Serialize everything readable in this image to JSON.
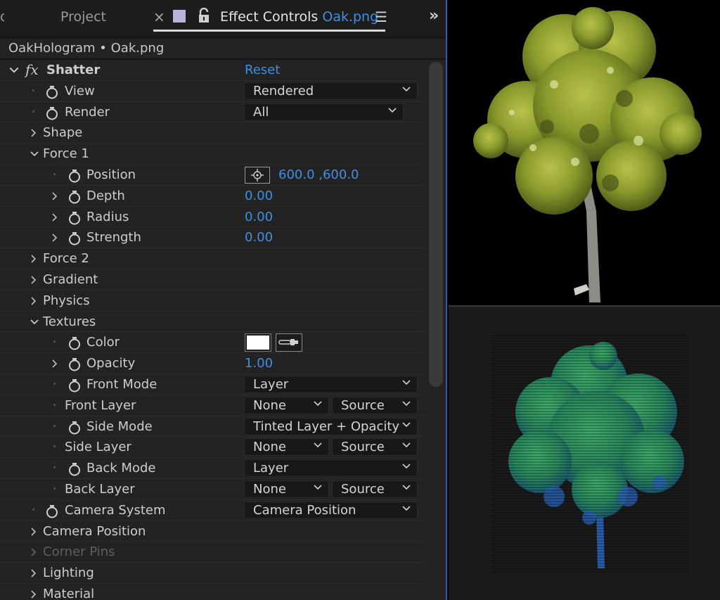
{
  "tabs": {
    "cut_label": "o",
    "project_label": "Project",
    "close_glyph": "×",
    "effect_controls_label": "Effect Controls",
    "file_label": "Oak.png",
    "menu_glyph": "☰",
    "more_glyph": "»"
  },
  "breadcrumb": "OakHologram • Oak.png",
  "effect": {
    "fx_glyph": "fx",
    "name": "Shatter",
    "reset_label": "Reset"
  },
  "properties": {
    "view": {
      "label": "View",
      "value": "Rendered"
    },
    "render": {
      "label": "Render",
      "value": "All"
    },
    "shape": {
      "label": "Shape"
    },
    "force1": {
      "label": "Force 1"
    },
    "position": {
      "label": "Position",
      "value": "600.0 ,600.0"
    },
    "depth": {
      "label": "Depth",
      "value": "0.00"
    },
    "radius": {
      "label": "Radius",
      "value": "0.00"
    },
    "strength": {
      "label": "Strength",
      "value": "0.00"
    },
    "force2": {
      "label": "Force 2"
    },
    "gradient": {
      "label": "Gradient"
    },
    "physics": {
      "label": "Physics"
    },
    "textures": {
      "label": "Textures"
    },
    "color": {
      "label": "Color",
      "swatch": "#ffffff"
    },
    "opacity": {
      "label": "Opacity",
      "value": "1.00"
    },
    "front_mode": {
      "label": "Front Mode",
      "value": "Layer"
    },
    "front_layer": {
      "label": "Front Layer",
      "layer": "None",
      "source": "Source"
    },
    "side_mode": {
      "label": "Side Mode",
      "value": "Tinted Layer + Opacity"
    },
    "side_layer": {
      "label": "Side Layer",
      "layer": "None",
      "source": "Source"
    },
    "back_mode": {
      "label": "Back Mode",
      "value": "Layer"
    },
    "back_layer": {
      "label": "Back Layer",
      "layer": "None",
      "source": "Source"
    },
    "camera_system": {
      "label": "Camera System",
      "value": "Camera Position"
    },
    "camera_position": {
      "label": "Camera Position"
    },
    "corner_pins": {
      "label": "Corner Pins"
    },
    "lighting": {
      "label": "Lighting"
    },
    "material": {
      "label": "Material"
    }
  },
  "colors": {
    "panel_bg": "#232323",
    "accent_blue": "#3d8fe4",
    "panel_border": "#2d5fa8",
    "preview_top_bg": "#000000",
    "preview_bottom_bg": "#1b1b1b"
  },
  "icons": [
    "lock-icon",
    "stopwatch-icon",
    "chevron-right-icon",
    "chevron-down-icon",
    "target-icon",
    "eyedropper-icon",
    "hamburger-menu-icon",
    "double-chevron-icon"
  ]
}
